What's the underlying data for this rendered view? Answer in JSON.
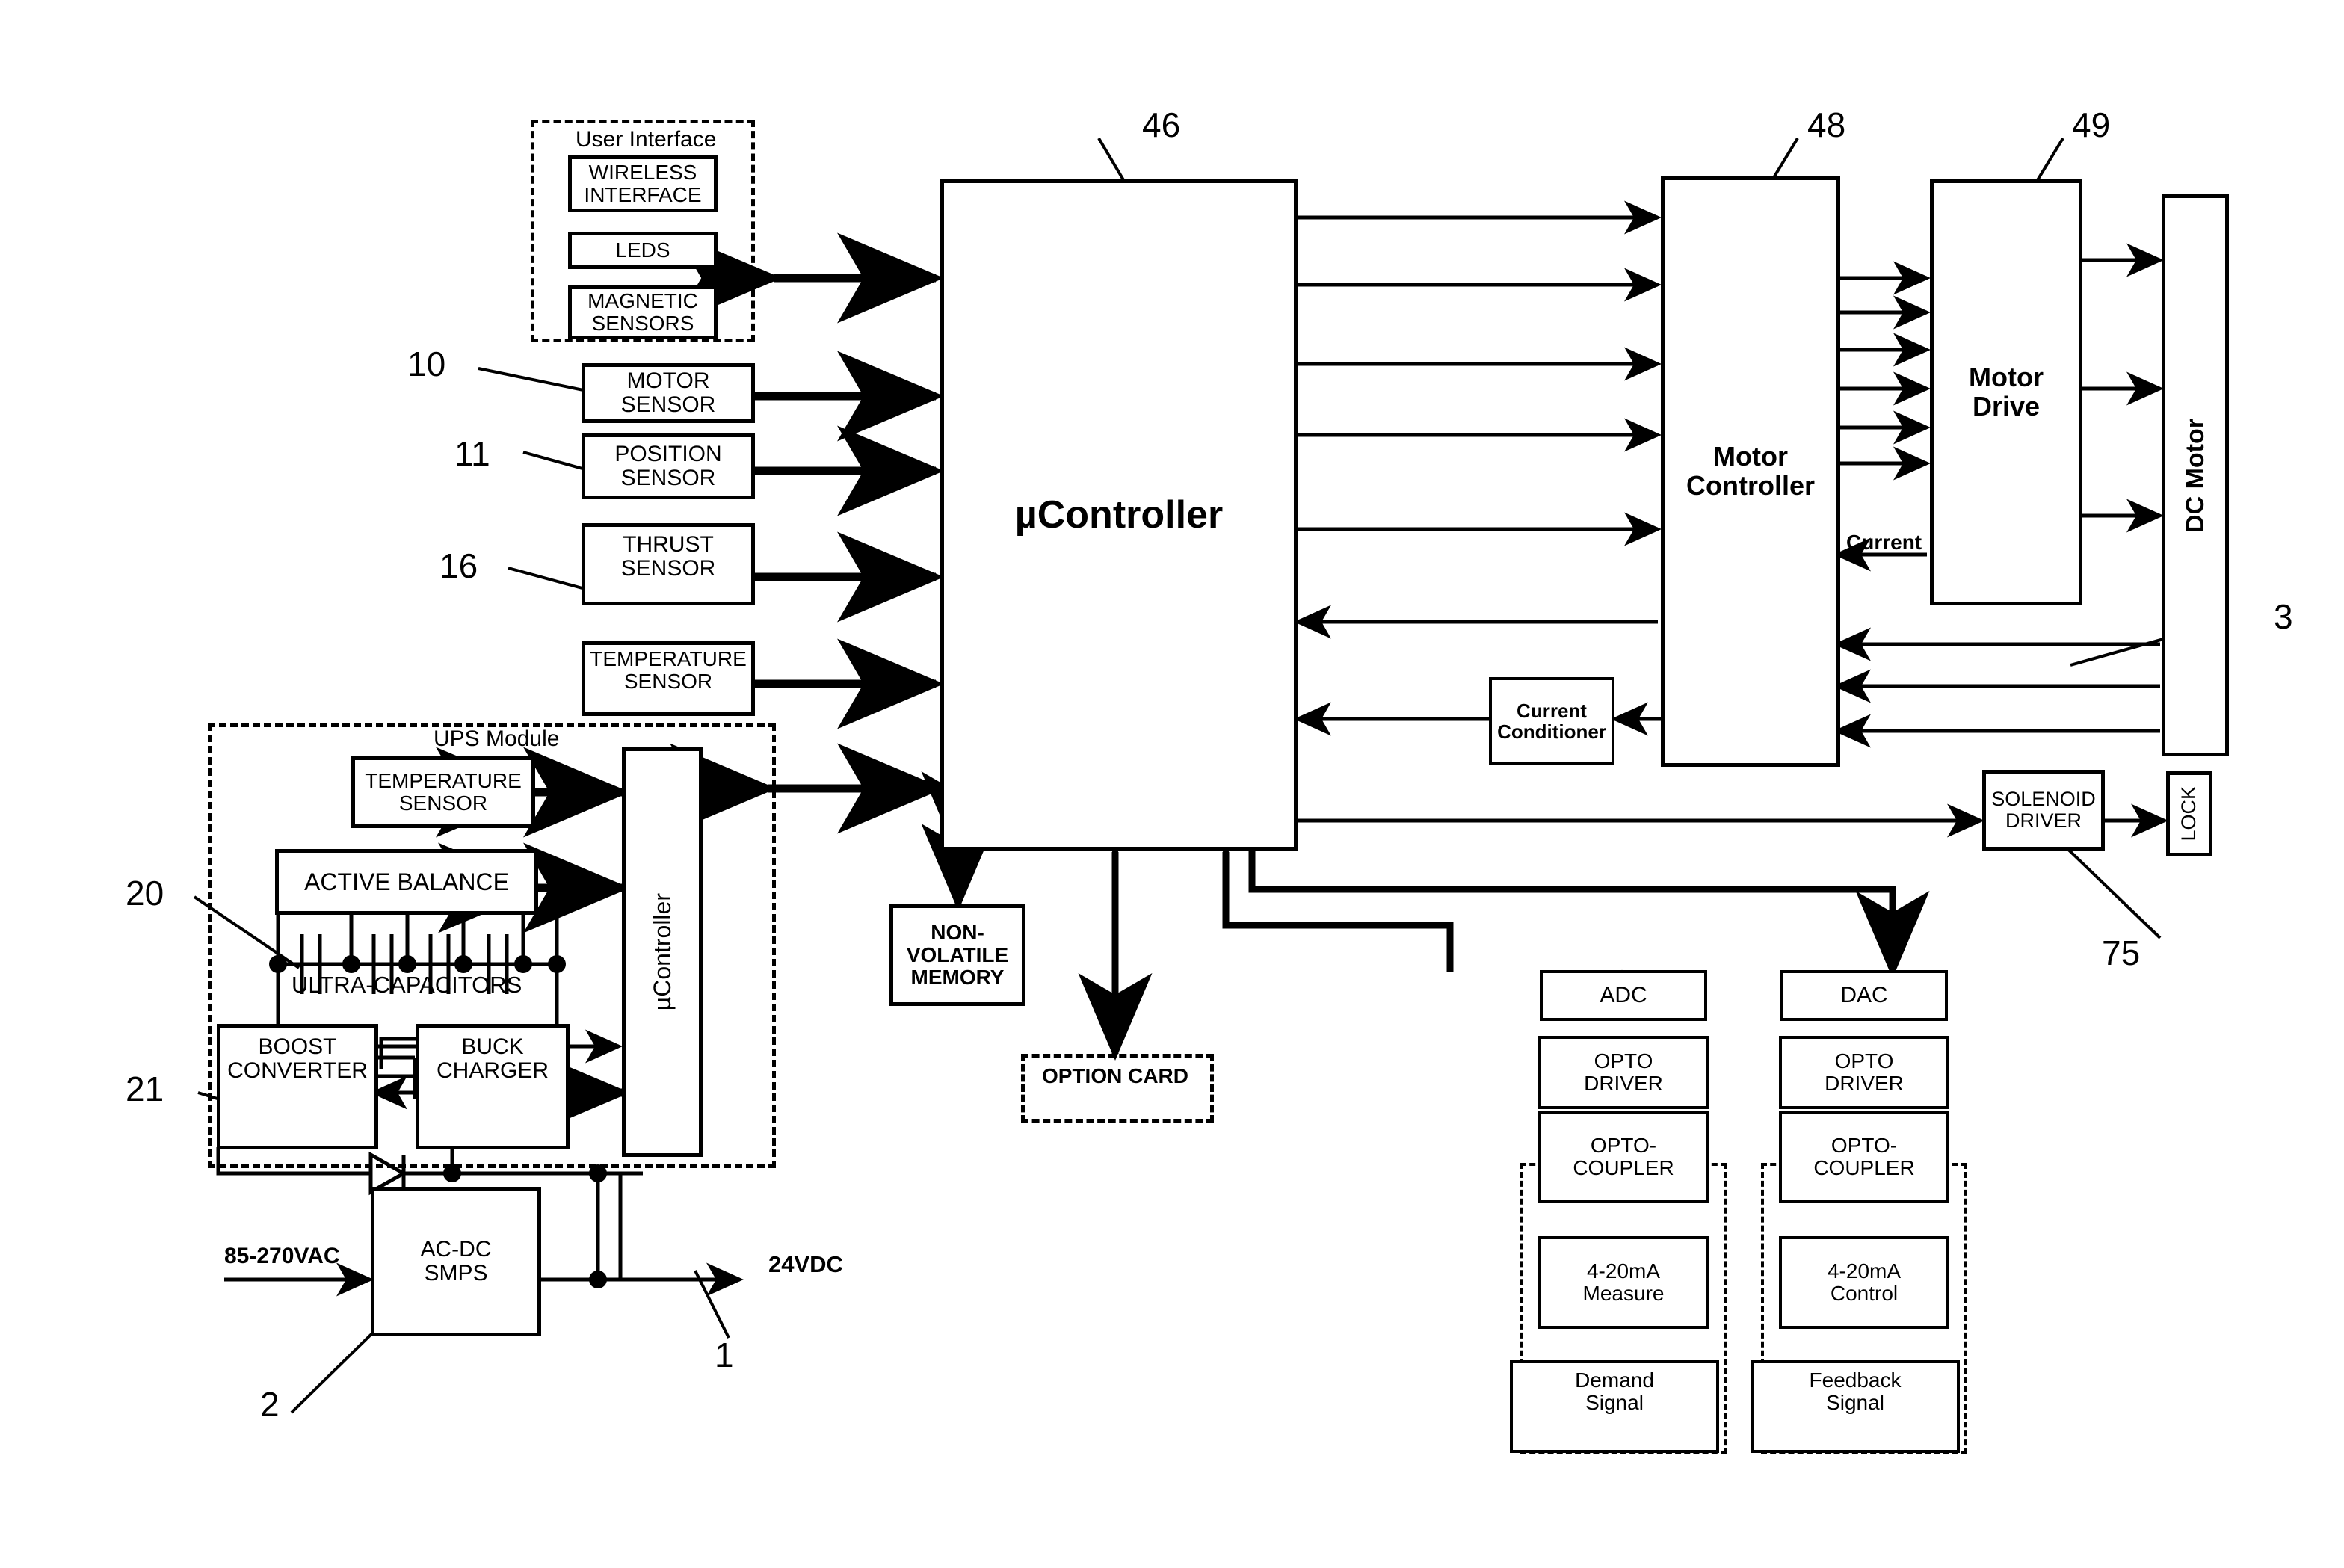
{
  "diagram": {
    "title_absent": true,
    "groups": {
      "user_interface": {
        "label": "User Interface"
      },
      "ups_module": {
        "label": "UPS Module"
      }
    },
    "blocks": {
      "wireless_interface": "WIRELESS\nINTERFACE",
      "leds": "LEDS",
      "magnetic_sensors": "MAGNETIC\nSENSORS",
      "motor_sensor": "MOTOR\nSENSOR",
      "position_sensor": "POSITION\nSENSOR",
      "thrust_sensor": "THRUST\nSENSOR",
      "temperature_sensor": "TEMPERATURE\nSENSOR",
      "ups_temperature_sensor": "TEMPERATURE\nSENSOR",
      "active_balance": "ACTIVE BALANCE",
      "ultra_capacitors": "ULTRA-CAPACITORS",
      "boost_converter": "BOOST\nCONVERTER",
      "buck_charger": "BUCK\nCHARGER",
      "ups_ucontroller": "µController",
      "ac_dc_smps": "AC-DC\nSMPS",
      "ucontroller": "µController",
      "non_volatile_memory": "NON-\nVOLATILE\nMEMORY",
      "option_card": "OPTION CARD",
      "motor_controller": "Motor\nController",
      "motor_drive": "Motor\nDrive",
      "dc_motor": "DC Motor",
      "current_conditioner": "Current\nConditioner",
      "solenoid_driver": "SOLENOID\nDRIVER",
      "lock": "LOCK",
      "adc": "ADC",
      "dac": "DAC",
      "opto_driver_left": "OPTO\nDRIVER",
      "opto_driver_right": "OPTO\nDRIVER",
      "opto_coupler_left": "OPTO-\nCOUPLER",
      "opto_coupler_right": "OPTO-\nCOUPLER",
      "measure_4_20ma": "4-20mA\nMeasure",
      "control_4_20ma": "4-20mA\nControl",
      "demand_signal": "Demand\nSignal",
      "feedback_signal": "Feedback\nSignal"
    },
    "signal_labels": {
      "ac_input": "85-270VAC",
      "dc_output": "24VDC",
      "current": "Current"
    },
    "reference_numerals": {
      "ref_1": "1",
      "ref_2": "2",
      "ref_3": "3",
      "ref_10": "10",
      "ref_11": "11",
      "ref_16": "16",
      "ref_20": "20",
      "ref_21": "21",
      "ref_46": "46",
      "ref_48": "48",
      "ref_49": "49",
      "ref_75": "75"
    },
    "colors": {
      "ink": "#000000",
      "paper": "#ffffff"
    }
  }
}
